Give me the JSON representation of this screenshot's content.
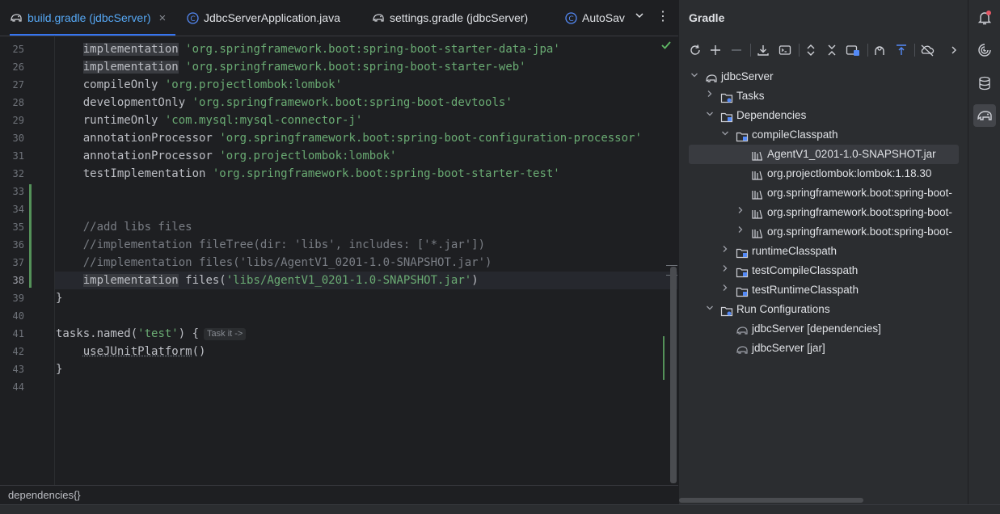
{
  "tabs": [
    {
      "label": "build.gradle (jdbcServer)",
      "icon": "gradle-elephant-icon"
    },
    {
      "label": "JdbcServerApplication.java",
      "icon": "java-class-icon"
    },
    {
      "label": "settings.gradle (jdbcServer)",
      "icon": "gradle-elephant-icon"
    },
    {
      "label": "AutoSav",
      "icon": "java-class-icon"
    }
  ],
  "editor": {
    "line_numbers": [
      "25",
      "26",
      "27",
      "28",
      "29",
      "30",
      "31",
      "32",
      "33",
      "34",
      "35",
      "36",
      "37",
      "38",
      "39",
      "40",
      "41",
      "42",
      "43",
      "44"
    ],
    "lines": {
      "l25": {
        "kw": "implementation",
        "str": "'org.springframework.boot:spring-boot-starter-data-jpa'"
      },
      "l26": {
        "kw": "implementation",
        "str": "'org.springframework.boot:spring-boot-starter-web'"
      },
      "l27": {
        "kw": "compileOnly",
        "str": "'org.projectlombok:lombok'"
      },
      "l28": {
        "kw": "developmentOnly",
        "str": "'org.springframework.boot:spring-boot-devtools'"
      },
      "l29": {
        "kw": "runtimeOnly",
        "str": "'com.mysql:mysql-connector-j'"
      },
      "l30": {
        "kw": "annotationProcessor",
        "str": "'org.springframework.boot:spring-boot-configuration-processor'"
      },
      "l31": {
        "kw": "annotationProcessor",
        "str": "'org.projectlombok:lombok'"
      },
      "l32": {
        "kw": "testImplementation",
        "str": "'org.springframework.boot:spring-boot-starter-test'"
      },
      "l35": {
        "cmt": "//add libs files"
      },
      "l36": {
        "cmt": "//implementation fileTree(dir: 'libs', includes: ['*.jar'])"
      },
      "l37": {
        "cmt": "//implementation files('libs/AgentV1_0201-1.0-SNAPSHOT.jar')"
      },
      "l38": {
        "kw": "implementation",
        "mid": " files(",
        "str": "'libs/AgentV1_0201-1.0-SNAPSHOT.jar'",
        "end": ")"
      },
      "l39": {
        "text": "}"
      },
      "l41": {
        "pre": "tasks.named(",
        "str": "'test'",
        "end": ") {",
        "hint": "Task it ->"
      },
      "l42": {
        "fn": "useJUnitPlatform",
        "end": "()"
      },
      "l43": {
        "text": "}"
      }
    },
    "breadcrumb": "dependencies{}"
  },
  "gradle": {
    "title": "Gradle",
    "toolbar": [
      "reload-icon",
      "add-icon",
      "remove-icon",
      "download-sources-icon",
      "execute-task-icon",
      "expand-all-icon",
      "collapse-all-icon",
      "link-project-icon",
      "analyze-deps-icon",
      "show-deps-icon",
      "offline-mode-icon",
      "more-icon"
    ],
    "tree": {
      "root": "jdbcServer",
      "tasks": "Tasks",
      "dependencies": "Dependencies",
      "compile_classpath": "compileClasspath",
      "jar_agent": "AgentV1_0201-1.0-SNAPSHOT.jar",
      "jar_lombok": "org.projectlombok:lombok:1.18.30",
      "jar_spring1": "org.springframework.boot:spring-boot-",
      "jar_spring2": "org.springframework.boot:spring-boot-",
      "jar_spring3": "org.springframework.boot:spring-boot-",
      "runtime_classpath": "runtimeClasspath",
      "test_compile_classpath": "testCompileClasspath",
      "test_runtime_classpath": "testRuntimeClasspath",
      "run_configurations": "Run Configurations",
      "run_deps": "jdbcServer [dependencies]",
      "run_jar": "jdbcServer [jar]"
    }
  },
  "rightbar": [
    "notifications-icon",
    "ai-assistant-icon",
    "database-icon",
    "gradle-icon"
  ],
  "colors": {
    "accent": "#3574f0",
    "string": "#6aab73",
    "comment": "#7a7e85",
    "vcs_added": "#549159"
  }
}
